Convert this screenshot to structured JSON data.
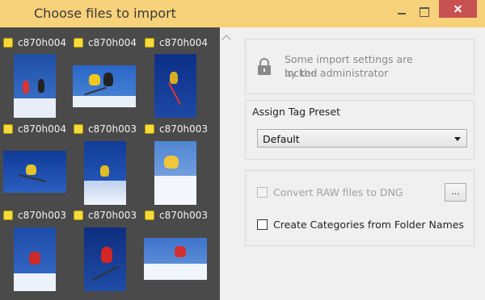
{
  "window": {
    "title": "Choose files to import"
  },
  "thumbnails": [
    {
      "name": "c870h004"
    },
    {
      "name": "c870h004"
    },
    {
      "name": "c870h004"
    },
    {
      "name": "c870h004"
    },
    {
      "name": "c870h003"
    },
    {
      "name": "c870h003"
    },
    {
      "name": "c870h003"
    },
    {
      "name": "c870h003"
    },
    {
      "name": "c870h003"
    }
  ],
  "lock_notice": {
    "icon": "lock-icon",
    "line1": "Some import settings are locked",
    "line2": "by the administrator"
  },
  "tag_preset": {
    "title": "Assign Tag Preset",
    "selected": "Default"
  },
  "options": {
    "convert_raw": {
      "label": "Convert RAW files to DNG",
      "checked": false,
      "enabled": false
    },
    "dng_settings_button": "...",
    "create_categories": {
      "label": "Create Categories from Folder Names",
      "checked": false,
      "enabled": true
    }
  },
  "colors": {
    "titlebar": "#f8d27a",
    "thumb_panel": "#4a4a4a",
    "close": "#c75050",
    "select_marker": "#f5dc3c"
  }
}
